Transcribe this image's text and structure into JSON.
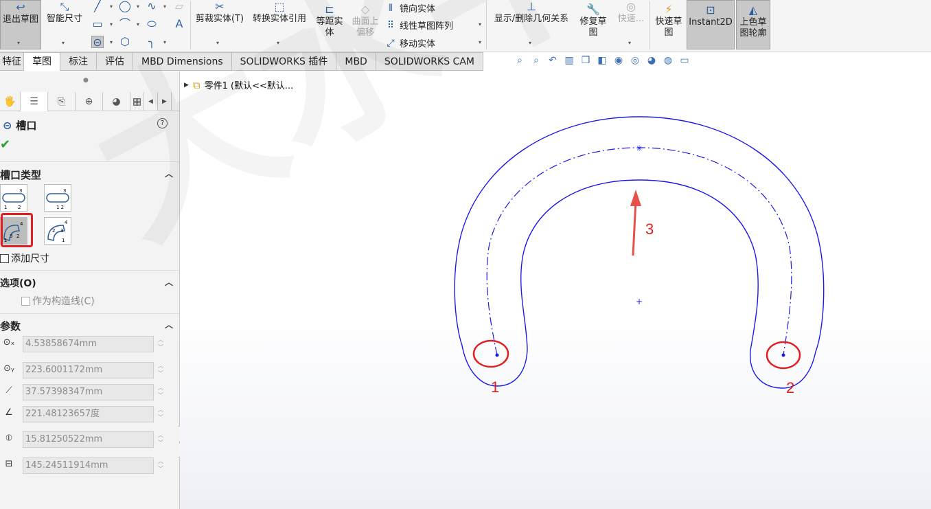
{
  "toolbar": {
    "exit_sketch": "退出草图",
    "smart_dim": "智能尺寸",
    "trim": "剪裁实体(T)",
    "convert": "转换实体引用",
    "offset": "等距实体",
    "surface_offset_line1": "曲面上",
    "surface_offset_line2": "偏移",
    "mirror": "镜向实体",
    "linear_pattern": "线性草图阵列",
    "move": "移动实体",
    "relations": "显示/删除几何关系",
    "repair_line1": "修复草",
    "repair_line2": "图",
    "quick_snaps": "快速...",
    "rapid_line1": "快速草",
    "rapid_line2": "图",
    "instant2d": "Instant2D",
    "shaded_line1": "上色草",
    "shaded_line2": "图轮廓"
  },
  "tabs": [
    "特征",
    "草图",
    "标注",
    "评估",
    "MBD Dimensions",
    "SOLIDWORKS 插件",
    "MBD",
    "SOLIDWORKS CAM"
  ],
  "active_tab": "草图",
  "property_manager": {
    "title": "槽口",
    "help": "?",
    "slot_type_header": "槽口类型",
    "add_dimensions": "添加尺寸",
    "options_header": "选项(O)",
    "construction": "作为构造线(C)",
    "params_header": "参数",
    "params": [
      {
        "icon": "center-x-icon",
        "value": "4.53858674mm"
      },
      {
        "icon": "center-y-icon",
        "value": "223.6001172mm"
      },
      {
        "icon": "radius-icon",
        "value": "37.57398347mm"
      },
      {
        "icon": "angle-icon",
        "value": "221.48123657度"
      },
      {
        "icon": "slot-width-icon",
        "value": "15.81250522mm"
      },
      {
        "icon": "slot-length-icon",
        "value": "145.24511914mm"
      }
    ]
  },
  "tree": {
    "root": "零件1 (默认<<默认..."
  },
  "annotations": {
    "p1": "1",
    "p2": "2",
    "p3": "3"
  },
  "watermark": "大水牛测绘",
  "colors": {
    "sketch": "#1a1ae6",
    "annotation": "#e02020",
    "accent": "#2b5f9e"
  }
}
